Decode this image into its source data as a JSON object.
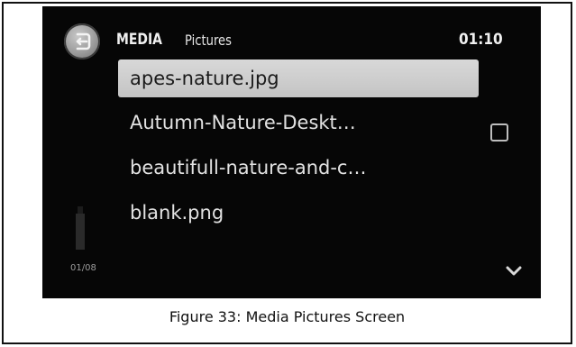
{
  "header": {
    "title": "MEDIA",
    "subtitle": "Pictures",
    "clock": "01:10"
  },
  "files": [
    {
      "label": "apes-nature.jpg",
      "selected": true
    },
    {
      "label": "Autumn-Nature-Deskt…",
      "selected": false
    },
    {
      "label": "beautifull-nature-and-c…",
      "selected": false
    },
    {
      "label": "blank.png",
      "selected": false
    }
  ],
  "pager": {
    "count": "01/08"
  },
  "caption": "Figure 33: Media Pictures Screen",
  "icons": {
    "back": "back-arrow-icon",
    "checkbox": "checkbox-icon",
    "scroll_down": "chevron-down-icon"
  },
  "colors": {
    "screen_bg": "#060606",
    "selection": "#cfcfcf",
    "text": "#e2e2e2"
  }
}
